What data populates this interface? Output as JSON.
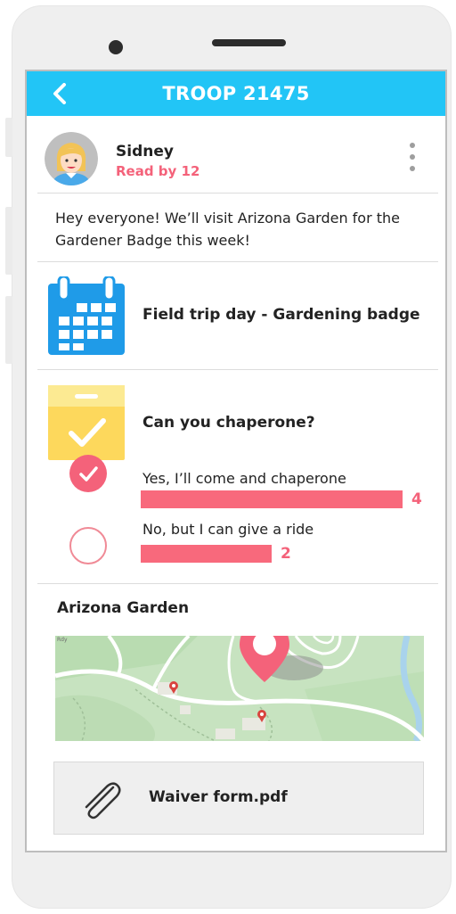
{
  "header": {
    "title": "TROOP 21475",
    "back_icon": "chevron-left-icon"
  },
  "post": {
    "author": "Sidney",
    "read_by": "Read by 12",
    "message": "Hey everyone! We’ll visit Arizona Garden for the Gardener Badge this week!",
    "menu_icon": "more-vertical-icon"
  },
  "event": {
    "icon": "calendar-icon",
    "title": "Field trip day - Gardening badge"
  },
  "poll": {
    "icon": "ballot-box-icon",
    "question": "Can you chaperone?",
    "options": [
      {
        "label": "Yes, I’ll come and chaperone",
        "count": "4",
        "fraction": 1.0,
        "selected": true
      },
      {
        "label": "No, but I can give a ride",
        "count": "2",
        "fraction": 0.5,
        "selected": false
      }
    ]
  },
  "location": {
    "title": "Arizona Garden",
    "map_label": "Rdy",
    "pin_icon": "map-pin-icon"
  },
  "attachment": {
    "icon": "paperclip-icon",
    "name": "Waiver form.pdf"
  },
  "colors": {
    "accent": "#22c5f6",
    "highlight": "#f4627a",
    "calendar": "#1f9be8",
    "box": "#fdd85c"
  }
}
